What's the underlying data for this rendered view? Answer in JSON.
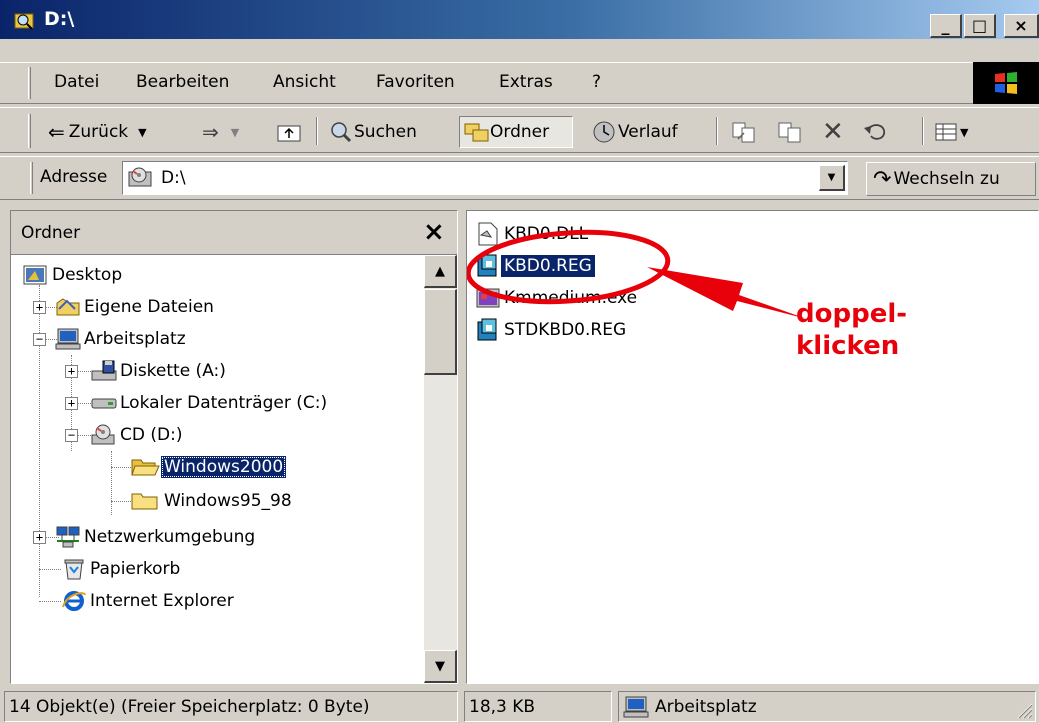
{
  "window": {
    "title": "D:\\",
    "buttons": {
      "minimize": "_",
      "maximize": "□",
      "close": "×"
    }
  },
  "menubar": {
    "items": [
      "Datei",
      "Bearbeiten",
      "Ansicht",
      "Favoriten",
      "Extras",
      "?"
    ]
  },
  "toolbar": {
    "back": "Zurück",
    "search": "Suchen",
    "folders": "Ordner",
    "history": "Verlauf"
  },
  "addressbar": {
    "label": "Adresse",
    "value": "D:\\",
    "go_button": "Wechseln zu"
  },
  "folders_pane": {
    "title": "Ordner",
    "close_glyph": "×",
    "tree": [
      {
        "label": "Desktop",
        "icon": "desktop-icon"
      },
      {
        "label": "Eigene Dateien",
        "icon": "my-documents-icon",
        "expander": "+"
      },
      {
        "label": "Arbeitsplatz",
        "icon": "my-computer-icon",
        "expander": "−"
      },
      {
        "label": "Diskette (A:)",
        "icon": "floppy-drive-icon",
        "expander": "+"
      },
      {
        "label": "Lokaler Datenträger (C:)",
        "icon": "hard-drive-icon",
        "expander": "+"
      },
      {
        "label": "CD (D:)",
        "icon": "cd-drive-icon",
        "expander": "−"
      },
      {
        "label": "Windows2000",
        "icon": "folder-open-icon",
        "selected": true
      },
      {
        "label": "Windows95_98",
        "icon": "folder-icon"
      },
      {
        "label": "Netzwerkumgebung",
        "icon": "network-icon",
        "expander": "+"
      },
      {
        "label": "Papierkorb",
        "icon": "recycle-bin-icon"
      },
      {
        "label": "Internet Explorer",
        "icon": "ie-icon"
      }
    ]
  },
  "files": [
    {
      "name": "KBD0.DLL",
      "icon": "dll-file-icon"
    },
    {
      "name": "KBD0.REG",
      "icon": "reg-file-icon",
      "selected": true
    },
    {
      "name": "Kmmedium.exe",
      "icon": "exe-file-icon"
    },
    {
      "name": "STDKBD0.REG",
      "icon": "reg-file-icon"
    }
  ],
  "annotation": {
    "line1": "doppel-",
    "line2": "klicken",
    "color": "#e8000b"
  },
  "statusbar": {
    "objects": "14 Objekt(e) (Freier Speicherplatz: 0 Byte)",
    "size": "18,3 KB",
    "zone": "Arbeitsplatz"
  }
}
